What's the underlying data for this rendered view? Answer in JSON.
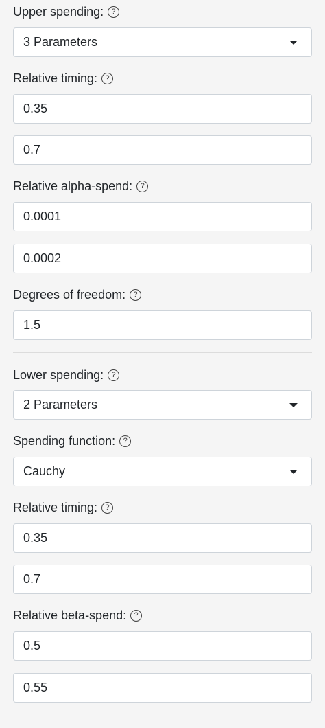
{
  "upper": {
    "spending_label": "Upper spending:",
    "spending_value": "3 Parameters",
    "timing_label": "Relative timing:",
    "timing_values": [
      "0.35",
      "0.7"
    ],
    "alpha_label": "Relative alpha-spend:",
    "alpha_values": [
      "0.0001",
      "0.0002"
    ],
    "df_label": "Degrees of freedom:",
    "df_value": "1.5"
  },
  "lower": {
    "spending_label": "Lower spending:",
    "spending_value": "2 Parameters",
    "function_label": "Spending function:",
    "function_value": "Cauchy",
    "timing_label": "Relative timing:",
    "timing_values": [
      "0.35",
      "0.7"
    ],
    "beta_label": "Relative beta-spend:",
    "beta_values": [
      "0.5",
      "0.55"
    ]
  },
  "help_glyph": "?",
  "icons": {
    "help": "question-circle-icon",
    "dropdown": "caret-down-icon"
  }
}
